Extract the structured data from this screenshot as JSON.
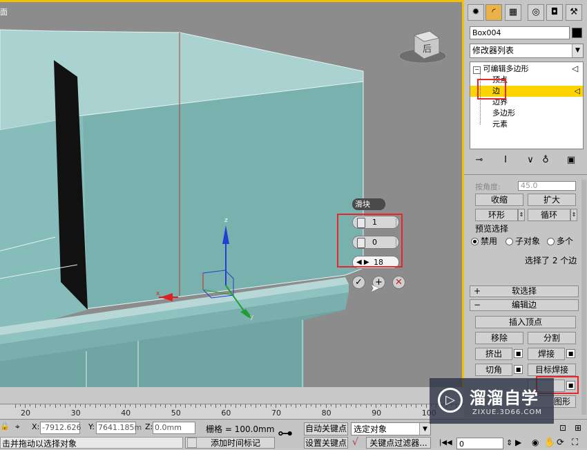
{
  "viewport": {
    "label": "面",
    "viewcube_label": "后",
    "axis_labels": {
      "x": "x",
      "y": "y",
      "z": "z"
    }
  },
  "caddy": {
    "title": "滑块",
    "segments": "1",
    "pinch": "0",
    "slide": "18",
    "ok_icon": "check-icon",
    "apply_icon": "plus-icon",
    "cancel_icon": "close-icon"
  },
  "panel": {
    "tabs": [
      "create-icon",
      "modify-icon",
      "hierarchy-icon",
      "motion-icon",
      "display-icon",
      "utilities-icon"
    ],
    "object_name": "Box004",
    "modifier_list": "修改器列表",
    "stack": {
      "root": "可编辑多边形",
      "items": [
        "顶点",
        "边",
        "边界",
        "多边形",
        "元素"
      ],
      "selected_index": 1
    },
    "selection": {
      "angle_label": "按角度:",
      "angle_value": "45.0",
      "shrink": "收缩",
      "grow": "扩大",
      "ring": "环形",
      "loop": "循环",
      "preview_label": "预览选择",
      "preview_opts": [
        "禁用",
        "子对象",
        "多个"
      ],
      "status": "选择了 2 个边"
    },
    "rollouts": {
      "soft_sel": "软选择",
      "edit_edges": "编辑边"
    },
    "edit_edges": {
      "insert_vertex": "插入顶点",
      "remove": "移除",
      "split": "分割",
      "extrude": "挤出",
      "weld": "焊接",
      "chamfer": "切角",
      "target_weld": "目标焊接",
      "partial_bottom": "图形"
    }
  },
  "timeline": {
    "ticks": [
      "20",
      "30",
      "40",
      "50",
      "60",
      "70",
      "80",
      "90",
      "100"
    ]
  },
  "status": {
    "x_label": "X:",
    "x_value": "-7912.626",
    "y_label": "Y:",
    "y_value": "7641.185m",
    "z_label": "Z:",
    "z_value": "0.0mm",
    "grid": "栅格 = 100.0mm",
    "prompt": "击并拖动以选择对象",
    "add_time_tag": "添加时间标记",
    "auto_key": "自动关键点",
    "set_key": "设置关键点",
    "selected_object": "选定对象",
    "key_filters": "关键点过滤器...",
    "frame": "0"
  },
  "watermark": {
    "brand": "溜溜自学",
    "url": "ZIXUE.3D66.COM"
  },
  "colors": {
    "highlight": "#fcd500",
    "active_border": "#f2c200",
    "red_annotation": "#e8262a",
    "box_face": "#7fb7b5"
  }
}
